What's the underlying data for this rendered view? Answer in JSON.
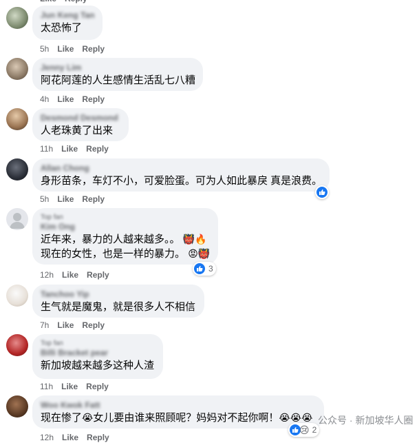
{
  "comments": [
    {
      "author": "Jun Keng Tan",
      "text": "太恐怖了",
      "time": "5h",
      "like": "Like",
      "reply": "Reply"
    },
    {
      "author": "Jenny Lim",
      "text": "阿花阿莲的人生感情生活乱七八糟",
      "time": "4h",
      "like": "Like",
      "reply": "Reply"
    },
    {
      "author": "Desmond Desmond",
      "text": "人老珠黄了出来",
      "time": "11h",
      "like": "Like",
      "reply": "Reply"
    },
    {
      "author": "Allan Chong",
      "text": "身形苗条，车灯不小，可爱脸蛋。可为人如此暴戾 真是浪费。",
      "time": "5h",
      "like": "Like",
      "reply": "Reply"
    },
    {
      "badge": "Top fan",
      "author": "Kim Ong",
      "text": "近年来，暴力的人越来越多。。",
      "text2": "现在的女性，也是一样的暴力。",
      "time": "12h",
      "like": "Like",
      "reply": "Reply",
      "reaction_count": "3"
    },
    {
      "author": "Tanchoo Yip",
      "text": "生气就是魔鬼，就是很多人不相信",
      "time": "7h",
      "like": "Like",
      "reply": "Reply"
    },
    {
      "badge": "Top fan",
      "author": "Billi Bracket pear",
      "text": "新加坡越来越多这种人渣",
      "time": "11h",
      "like": "Like",
      "reply": "Reply"
    },
    {
      "author": "Woo Kwok Fatt",
      "text": "现在惨了",
      "text_mid": "女儿要由谁来照顾呢？妈妈对不起你啊！",
      "time": "12h",
      "like": "Like",
      "reply": "Reply",
      "reaction_count": "2"
    }
  ],
  "watermark": "公众号 · 新加坡华人圈",
  "colors": {
    "bubble": "#f0f2f5",
    "meta": "#65676b",
    "like_blue": "#1877f2"
  }
}
